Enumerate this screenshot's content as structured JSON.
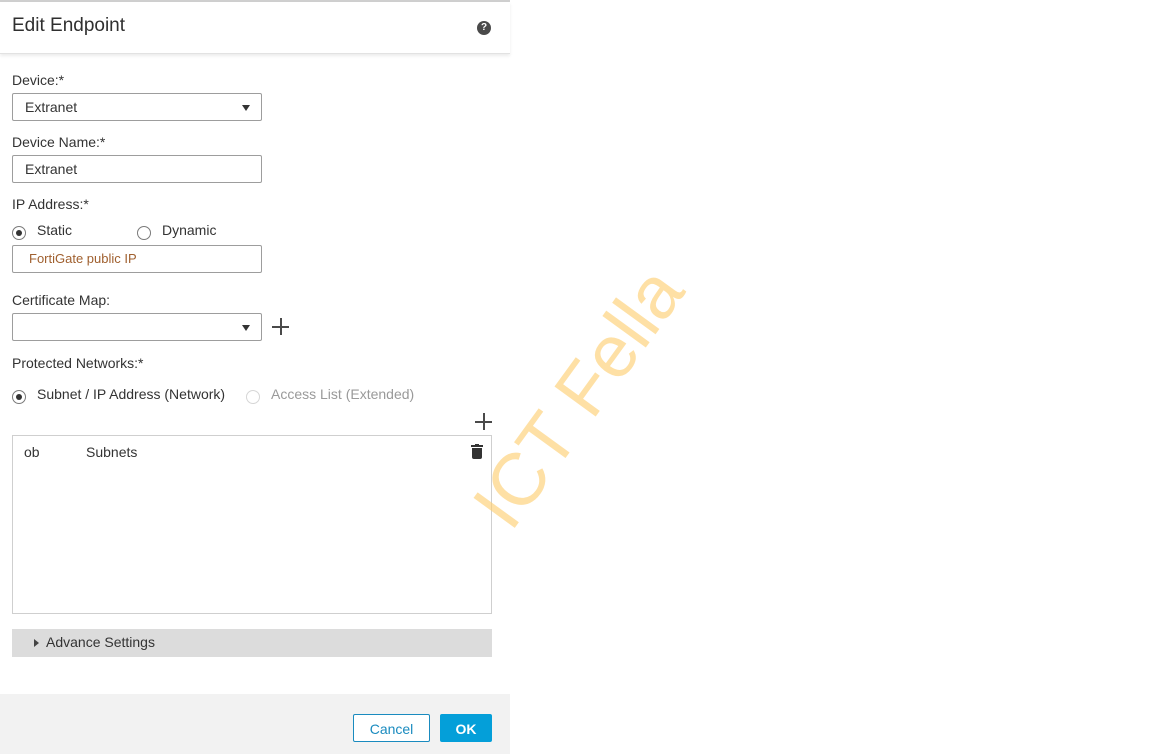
{
  "dialog": {
    "title": "Edit Endpoint",
    "help_glyph": "?"
  },
  "device": {
    "label": "Device:*",
    "value": "Extranet"
  },
  "device_name": {
    "label": "Device Name:*",
    "value": "Extranet"
  },
  "ip_address": {
    "label": "IP Address:*",
    "options": [
      {
        "label": "Static",
        "selected": true
      },
      {
        "label": "Dynamic",
        "selected": false
      }
    ],
    "value": "FortiGate public IP"
  },
  "certificate_map": {
    "label": "Certificate Map:",
    "value": ""
  },
  "protected_networks": {
    "label": "Protected Networks:*",
    "options": [
      {
        "label": "Subnet / IP Address (Network)",
        "selected": true,
        "disabled": false
      },
      {
        "label": "Access List (Extended)",
        "selected": false,
        "disabled": true
      }
    ],
    "table": {
      "columns": [
        "ob",
        "Subnets"
      ]
    }
  },
  "advanced": {
    "label": "Advance Settings"
  },
  "footer": {
    "cancel_label": "Cancel",
    "ok_label": "OK"
  },
  "watermark": {
    "text": "ICT Fella"
  },
  "colors": {
    "primary": "#049fd9",
    "cancel_border": "#1a8bbf",
    "watermark": "#fdcd6e",
    "ip_text": "#a0602f"
  }
}
